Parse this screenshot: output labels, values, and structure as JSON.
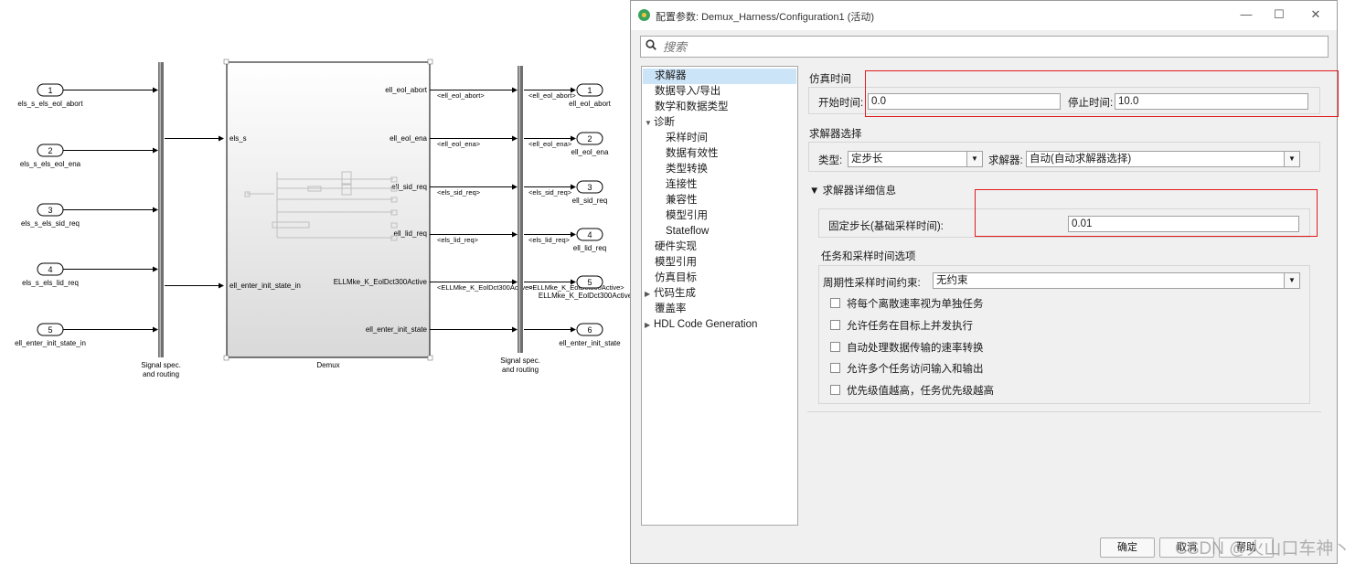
{
  "model": {
    "inports": [
      {
        "num": "1",
        "name": "els_s_els_eol_abort"
      },
      {
        "num": "2",
        "name": "els_s_els_eol_ena"
      },
      {
        "num": "3",
        "name": "els_s_els_sid_req"
      },
      {
        "num": "4",
        "name": "els_s_els_lid_req"
      },
      {
        "num": "5",
        "name": "ell_enter_init_state_in"
      }
    ],
    "signal_spec_left": "Signal spec.",
    "signal_spec_left2": "and routing",
    "signal_spec_right": "Signal spec.",
    "signal_spec_right2": "and routing",
    "demux_name": "Demux",
    "demux_in_ports": [
      "els_s",
      "ell_enter_init_state_in"
    ],
    "demux_out_ports": [
      "ell_eol_abort",
      "ell_eol_ena",
      "ell_sid_req",
      "ell_lid_req",
      "ELLMke_K_EolDct300Active",
      "ell_enter_init_state"
    ],
    "signal_labels": [
      "<ell_eol_abort>",
      "<ell_eol_ena>",
      "<els_sid_req>",
      "<els_lid_req>",
      "<ELLMke_K_EolDct300Active>",
      ""
    ],
    "right_signal_labels": [
      "<ell_eol_abort>",
      "<ell_eol_ena>",
      "<els_sid_req>",
      "<els_lid_req>",
      "<ELLMke_K_EolDct300Active>",
      ""
    ],
    "outports": [
      {
        "num": "1",
        "name": "ell_eol_abort"
      },
      {
        "num": "2",
        "name": "ell_eol_ena"
      },
      {
        "num": "3",
        "name": "ell_sid_req"
      },
      {
        "num": "4",
        "name": "ell_lid_req"
      },
      {
        "num": "5",
        "name": "ELLMke_K_EolDct300Active"
      },
      {
        "num": "6",
        "name": "ell_enter_init_state"
      }
    ]
  },
  "dialog": {
    "title": "配置参数: Demux_Harness/Configuration1 (活动)",
    "window_controls": {
      "min": "—",
      "max": "☐",
      "close": "✕"
    },
    "search_placeholder": "搜索",
    "tree": [
      {
        "label": "求解器",
        "selected": true
      },
      {
        "label": "数据导入/导出"
      },
      {
        "label": "数学和数据类型"
      },
      {
        "label": "诊断",
        "expander": "▼"
      },
      {
        "label": "采样时间"
      },
      {
        "label": "数据有效性"
      },
      {
        "label": "类型转换"
      },
      {
        "label": "连接性"
      },
      {
        "label": "兼容性"
      },
      {
        "label": "模型引用"
      },
      {
        "label": "Stateflow"
      },
      {
        "label": "硬件实现"
      },
      {
        "label": "模型引用"
      },
      {
        "label": "仿真目标"
      },
      {
        "label": "代码生成",
        "expander": "▶"
      },
      {
        "label": "覆盖率"
      },
      {
        "label": "HDL Code Generation",
        "expander": "▶"
      }
    ],
    "sim_time": {
      "section": "仿真时间",
      "start_label": "开始时间:",
      "start_value": "0.0",
      "stop_label": "停止时间:",
      "stop_value": "10.0"
    },
    "solver_select": {
      "section": "求解器选择",
      "type_label": "类型:",
      "type_value": "定步长",
      "solver_label": "求解器:",
      "solver_value": "自动(自动求解器选择)"
    },
    "solver_details": {
      "section": "▼ 求解器详细信息",
      "step_label": "固定步长(基础采样时间):",
      "step_value": "0.01"
    },
    "tasking": {
      "section": "任务和采样时间选项",
      "constraint_label": "周期性采样时间约束:",
      "constraint_value": "无约束",
      "options": [
        "将每个离散速率视为单独任务",
        "允许任务在目标上并发执行",
        "自动处理数据传输的速率转换",
        "允许多个任务访问输入和输出",
        "优先级值越高，任务优先级越高"
      ]
    },
    "buttons": {
      "ok": "确定",
      "cancel": "取消",
      "help": "帮助"
    }
  },
  "watermark": "CSDN @火山口车神丶"
}
